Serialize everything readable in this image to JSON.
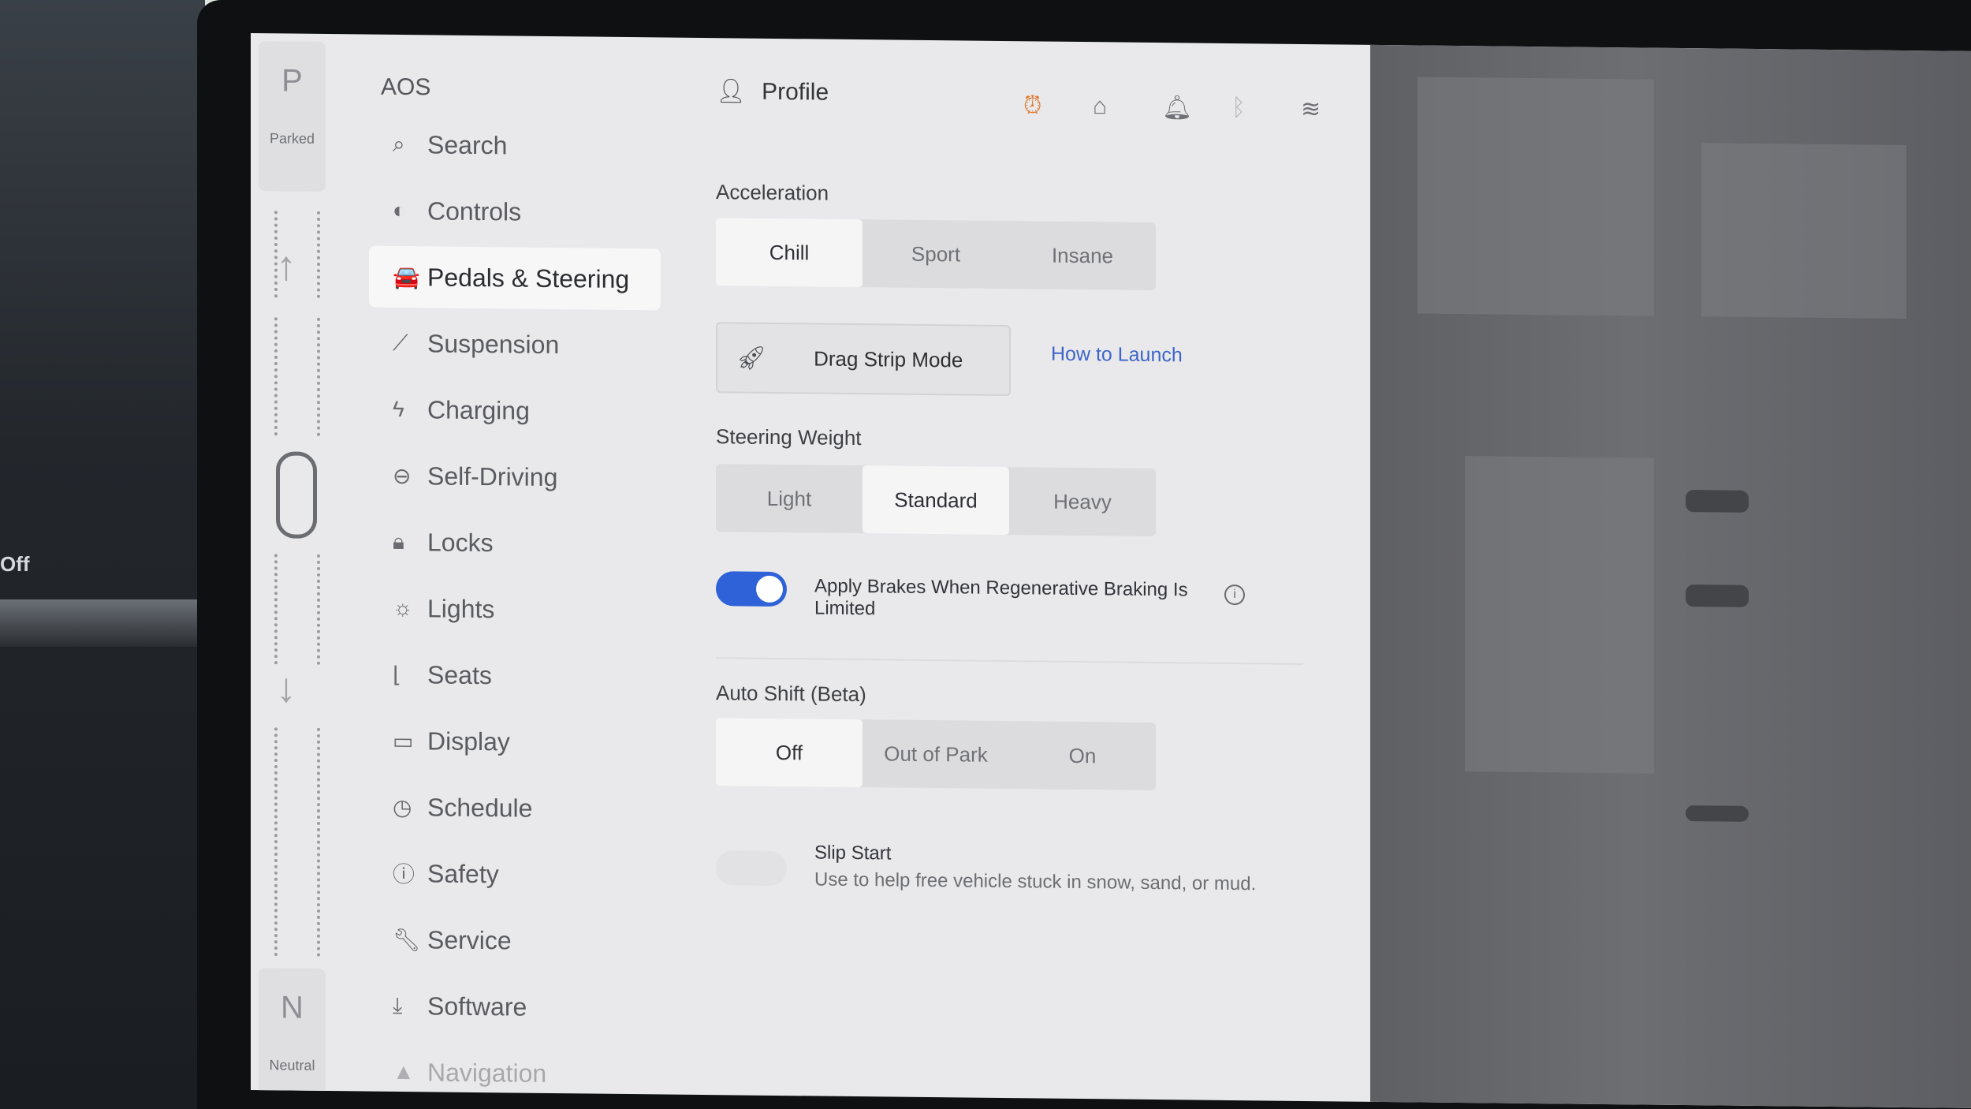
{
  "surroundings": {
    "left_label": "Off"
  },
  "gear": {
    "top": {
      "letter": "P",
      "name": "Parked"
    },
    "bottom": {
      "letter": "N",
      "name": "Neutral"
    }
  },
  "app_title": "AOS",
  "nav": [
    {
      "label": "Search",
      "icon": "search-icon",
      "glyph": "⌕"
    },
    {
      "label": "Controls",
      "icon": "toggle-icon",
      "glyph": "◐"
    },
    {
      "label": "Pedals & Steering",
      "icon": "car-icon",
      "glyph": "🚘"
    },
    {
      "label": "Suspension",
      "icon": "wrench-icon",
      "glyph": "⟋"
    },
    {
      "label": "Charging",
      "icon": "bolt-icon",
      "glyph": "ϟ"
    },
    {
      "label": "Self-Driving",
      "icon": "steering-wheel-icon",
      "glyph": "⊖"
    },
    {
      "label": "Locks",
      "icon": "lock-icon",
      "glyph": "🔒︎"
    },
    {
      "label": "Lights",
      "icon": "sun-icon",
      "glyph": "☼"
    },
    {
      "label": "Seats",
      "icon": "seat-icon",
      "glyph": "⌊"
    },
    {
      "label": "Display",
      "icon": "display-icon",
      "glyph": "▭"
    },
    {
      "label": "Schedule",
      "icon": "clock-icon",
      "glyph": "◷"
    },
    {
      "label": "Safety",
      "icon": "alert-icon",
      "glyph": "ⓘ"
    },
    {
      "label": "Service",
      "icon": "wrench-icon",
      "glyph": "🔧︎"
    },
    {
      "label": "Software",
      "icon": "download-icon",
      "glyph": "⤓"
    },
    {
      "label": "Navigation",
      "icon": "navigation-icon",
      "glyph": "▲"
    }
  ],
  "active_nav": "Pedals & Steering",
  "header": {
    "profile_label": "Profile",
    "icons": [
      "alarm-icon",
      "garage-icon",
      "bell-icon",
      "bluetooth-icon",
      "wifi-icon"
    ]
  },
  "acceleration": {
    "label": "Acceleration",
    "options": [
      "Chill",
      "Sport",
      "Insane"
    ],
    "selected": "Chill"
  },
  "drag_strip": {
    "label": "Drag Strip Mode",
    "link": "How to Launch"
  },
  "steering_weight": {
    "label": "Steering Weight",
    "options": [
      "Light",
      "Standard",
      "Heavy"
    ],
    "selected": "Standard"
  },
  "apply_brakes": {
    "label": "Apply Brakes When Regenerative Braking Is Limited",
    "enabled": true
  },
  "auto_shift": {
    "label": "Auto Shift (Beta)",
    "options": [
      "Off",
      "Out of Park",
      "On"
    ],
    "selected": "Off"
  },
  "slip_start": {
    "label": "Slip Start",
    "description": "Use to help free vehicle stuck in snow, sand, or mud.",
    "enabled": false
  },
  "colors": {
    "accent": "#2f62d8",
    "link": "#3e65c9",
    "alarm": "#e07a2f"
  }
}
